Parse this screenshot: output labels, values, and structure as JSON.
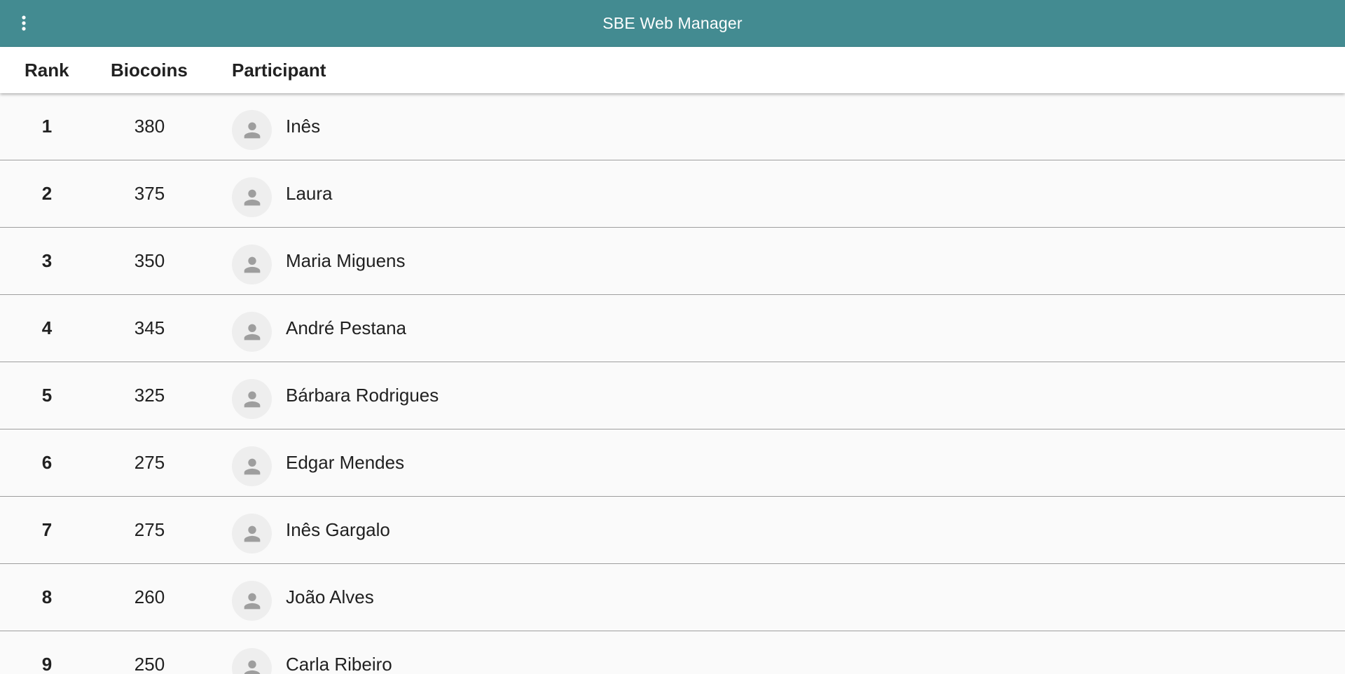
{
  "appbar": {
    "title": "SBE Web Manager",
    "menu_icon": "more-vert-icon",
    "background": "#438b91"
  },
  "table": {
    "headers": {
      "rank": "Rank",
      "biocoins": "Biocoins",
      "participant": "Participant"
    },
    "avatar_icon": "person-icon",
    "rows": [
      {
        "rank": "1",
        "biocoins": "380",
        "participant": "Inês"
      },
      {
        "rank": "2",
        "biocoins": "375",
        "participant": "Laura"
      },
      {
        "rank": "3",
        "biocoins": "350",
        "participant": "Maria Miguens"
      },
      {
        "rank": "4",
        "biocoins": "345",
        "participant": "André Pestana"
      },
      {
        "rank": "5",
        "biocoins": "325",
        "participant": "Bárbara Rodrigues"
      },
      {
        "rank": "6",
        "biocoins": "275",
        "participant": "Edgar Mendes"
      },
      {
        "rank": "7",
        "biocoins": "275",
        "participant": "Inês Gargalo"
      },
      {
        "rank": "8",
        "biocoins": "260",
        "participant": "João Alves"
      },
      {
        "rank": "9",
        "biocoins": "250",
        "participant": "Carla Ribeiro"
      }
    ]
  }
}
